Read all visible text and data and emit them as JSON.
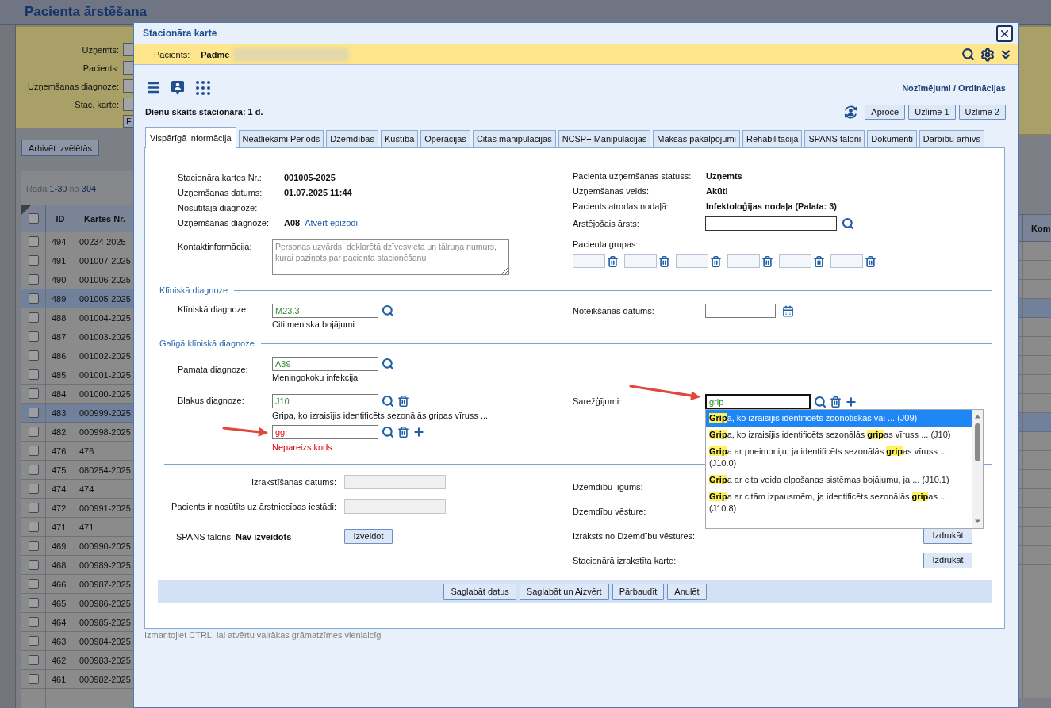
{
  "background_page": {
    "title": "Pacienta ārstēšana",
    "filters": [
      {
        "label": "Uzņemts:"
      },
      {
        "label": "Pacients:"
      },
      {
        "label": "Uzņemšanas diagnoze:"
      },
      {
        "label": "Stac. karte:"
      }
    ],
    "filter_button": "F",
    "archive_button": "Arhivēt izvēlētās",
    "paging": {
      "prefix": "Rāda",
      "range": "1-30",
      "middle": "no",
      "total": "304"
    },
    "table": {
      "select_all_checked": false,
      "columns": [
        "ID",
        "Kartes Nr."
      ],
      "right_column": "Kom",
      "rows": [
        {
          "id": "494",
          "card": "00234-2025",
          "checked": false,
          "highlighted": false
        },
        {
          "id": "491",
          "card": "001007-2025",
          "checked": false,
          "highlighted": false
        },
        {
          "id": "490",
          "card": "001006-2025",
          "checked": false,
          "highlighted": false
        },
        {
          "id": "489",
          "card": "001005-2025",
          "checked": false,
          "highlighted": true
        },
        {
          "id": "488",
          "card": "001004-2025",
          "checked": false,
          "highlighted": false
        },
        {
          "id": "487",
          "card": "001003-2025",
          "checked": false,
          "highlighted": false
        },
        {
          "id": "486",
          "card": "001002-2025",
          "checked": false,
          "highlighted": false
        },
        {
          "id": "485",
          "card": "001001-2025",
          "checked": false,
          "highlighted": false
        },
        {
          "id": "484",
          "card": "001000-2025",
          "checked": false,
          "highlighted": false
        },
        {
          "id": "483",
          "card": "000999-2025",
          "checked": false,
          "highlighted": true
        },
        {
          "id": "482",
          "card": "000998-2025",
          "checked": false,
          "highlighted": false
        },
        {
          "id": "476",
          "card": "476",
          "checked": false,
          "highlighted": false
        },
        {
          "id": "475",
          "card": "080254-2025",
          "checked": false,
          "highlighted": false
        },
        {
          "id": "474",
          "card": "474",
          "checked": false,
          "highlighted": false
        },
        {
          "id": "472",
          "card": "000991-2025",
          "checked": false,
          "highlighted": false
        },
        {
          "id": "471",
          "card": "471",
          "checked": false,
          "highlighted": false
        },
        {
          "id": "469",
          "card": "000990-2025",
          "checked": false,
          "highlighted": false
        },
        {
          "id": "468",
          "card": "000989-2025",
          "checked": false,
          "highlighted": false
        },
        {
          "id": "466",
          "card": "000987-2025",
          "checked": false,
          "highlighted": false
        },
        {
          "id": "465",
          "card": "000986-2025",
          "checked": false,
          "highlighted": false
        },
        {
          "id": "464",
          "card": "000985-2025",
          "checked": false,
          "highlighted": false
        },
        {
          "id": "463",
          "card": "000984-2025",
          "checked": false,
          "highlighted": false
        },
        {
          "id": "462",
          "card": "000983-2025",
          "checked": false,
          "highlighted": false
        },
        {
          "id": "461",
          "card": "000982-2025",
          "checked": false,
          "highlighted": false
        }
      ]
    }
  },
  "dialog": {
    "title": "Stacionāra karte",
    "patient_bar": {
      "label": "Pacients:",
      "name": "Padme"
    },
    "orders_link": "Nozīmējumi / Ordinācijas",
    "days_in_hospital": "Dienu skaits stacionārā: 1 d.",
    "print_buttons": [
      "Aproce",
      "Uzlīme 1",
      "Uzlīme 2"
    ],
    "tabs": [
      {
        "label": "Vispārīgā informācija",
        "selected": true
      },
      {
        "label": "Neatliekami Periods",
        "selected": false
      },
      {
        "label": "Dzemdības",
        "selected": false
      },
      {
        "label": "Kustība",
        "selected": false
      },
      {
        "label": "Operācijas",
        "selected": false
      },
      {
        "label": "Citas manipulācijas",
        "selected": false
      },
      {
        "label": "NCSP+ Manipulācijas",
        "selected": false
      },
      {
        "label": "Maksas pakalpojumi",
        "selected": false
      },
      {
        "label": "Rehabilitācija",
        "selected": false
      },
      {
        "label": "SPANS taloni",
        "selected": false
      },
      {
        "label": "Dokumenti",
        "selected": false
      },
      {
        "label": "Darbību arhīvs",
        "selected": false
      }
    ],
    "general": {
      "left_fields": [
        {
          "label": "Stacionāra kartes Nr.:",
          "value": "001005-2025"
        },
        {
          "label": "Uzņemšanas datums:",
          "value": "01.07.2025 11:44"
        },
        {
          "label": "Nosūtītāja diagnoze:"
        },
        {
          "label": "Uzņemšanas diagnoze:",
          "value": "A08",
          "link": "Atvērt epizodi"
        }
      ],
      "contact": {
        "label": "Kontaktinformācija:",
        "placeholder": "Personas uzvārds, deklarētā dzīvesvieta un tālruņa numurs, kurai paziņots par pacienta stacionēšanu"
      },
      "right_fields": [
        {
          "label": "Pacienta uzņemšanas statuss:",
          "value": "Uzņemts"
        },
        {
          "label": "Uzņemšanas veids:",
          "value": "Akūti"
        },
        {
          "label": "Pacients atrodas nodaļā:",
          "value": "Infektoloģijas nodaļa (Palata: 3)"
        }
      ],
      "doctor": {
        "label": "Ārstējošais ārsts:"
      },
      "patient_groups": {
        "label": "Pacienta grupas:",
        "fields": [
          {
            "kind": "group"
          },
          {
            "kind": "group"
          },
          {
            "kind": "group"
          },
          {
            "kind": "group"
          },
          {
            "kind": "group"
          },
          {
            "kind": "group"
          }
        ]
      }
    },
    "clinical_diagnosis": {
      "title": "Klīniskā diagnoze",
      "label": "Klīniskā diagnoze:",
      "code": "M23.3",
      "valid": true,
      "description": "Citi meniska bojājumi",
      "date_label": "Noteikšanas datums:"
    },
    "final_diagnosis": {
      "title": "Galīgā klīniskā diagnoze",
      "main": {
        "label": "Pamata diagnoze:",
        "code": "A39",
        "valid": true,
        "description": "Meningokoku infekcija"
      },
      "secondary": {
        "label": "Blakus diagnoze:",
        "entries": [
          {
            "code": "J10",
            "valid": true,
            "description": "Gripa, ko izraisījis identificēts sezonālās gripas vīruss ..."
          },
          {
            "code": "ggr",
            "valid": false,
            "error": "Nepareizs kods"
          }
        ]
      },
      "complications": {
        "label": "Sarežģījumi:",
        "value": "grip",
        "focused": true,
        "suggestions": [
          {
            "text": "**Grip**a, ko izraisījis identificēts zoonotiskas vai ... (J09)",
            "selected": true
          },
          {
            "text": "**Grip**a, ko izraisījis identificēts sezonālās **grip**as vīruss ... (J10)",
            "selected": false
          },
          {
            "text": "**Grip**a ar pneimoniju, ja identificēts sezonālās **grip**as vīruss ... (J10.0)",
            "selected": false
          },
          {
            "text": "**Grip**a ar cita veida elpošanas sistēmas bojājumu, ja ... (J10.1)",
            "selected": false
          },
          {
            "text": "**Grip**a ar citām izpausmēm, ja identificēts sezonālās **grip**as ... (J10.8)",
            "selected": false
          }
        ]
      }
    },
    "discharge": {
      "left_fields": [
        {
          "label": "Izrakstīšanas datums:",
          "disabled": true
        },
        {
          "label": "Pacients ir nosūtīts uz ārstniecības iestādi:",
          "disabled": true
        }
      ],
      "spans": {
        "label": "SPANS talons:",
        "value": "Nav izveidots",
        "button": "Izveidot"
      },
      "right_fields": [
        {
          "label": "Dzemdību līgums:"
        },
        {
          "label": "Dzemdību vēsture:"
        },
        {
          "label": "Izraksts no Dzemdību vēstures:",
          "button": "Izdrukāt"
        },
        {
          "label": "Stacionārā izrakstīta karte:",
          "button": "Izdrukāt"
        }
      ]
    },
    "actions": [
      "Saglabāt datus",
      "Saglabāt un Aizvērt",
      "Pārbaudīt",
      "Anulēt"
    ],
    "hint": "Izmantojiet CTRL, lai atvērtu vairākas grāmatzīmes vienlaicīgi"
  }
}
